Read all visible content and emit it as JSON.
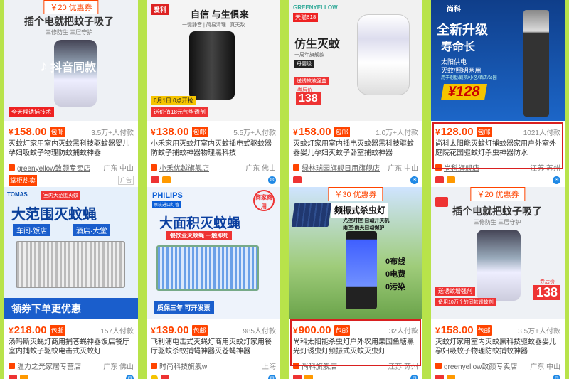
{
  "cards": [
    {
      "coupon": "￥20 优惠券",
      "banner_main": "插个电就把蚊子吸了",
      "banner_sub": "三修防生 三层守护",
      "overlay": "抖音同款",
      "badge": "全天候诱捕技术",
      "price": "158.00",
      "tag": "包邮",
      "sales": "3.5万+人付款",
      "title": "灭蚊灯家用室内灭蚊黑科技驱蚊器婴儿孕妇吸蚊子物理防蚊捕蚊神器",
      "shop": "greenyellow致颜专卖店",
      "location": "广东 中山",
      "extra_badge": "掌柜热卖",
      "ad": "广告"
    },
    {
      "brand": "爱科",
      "banner_main": "自信 与生俱来",
      "banner_sub": "一键静音 | 简易清理 | 真无敌",
      "date_badge": "6月1日 0点开抢",
      "promo": "送价值18元气垫诱剂",
      "price": "138.00",
      "tag": "包邮",
      "sales": "5.5万+人付款",
      "title": "小禾家用灭蚊灯室内灭蚊插电式驱蚊器防蚊子捕蚊神器物理黑科技",
      "shop": "小禾优越旗舰店",
      "location": "广东 佛山"
    },
    {
      "brand": "GREENYELLOW",
      "tmall": "天猫618",
      "banner_main": "仿生灭蚊",
      "banner_sub": "十周年旗舰款",
      "banner_sub2": "母婴级",
      "promo": "送诱蚊液强盒",
      "price_tag_label": "券后价",
      "price_tag": "138",
      "price": "158.00",
      "tag": "包邮",
      "sales": "1.0万+人付款",
      "title": "灭蚊灯家用室内插电灭蚊器黑科技驱蚊器婴儿孕妇灭蚊子卧室捕蚊神器",
      "shop": "绿林瑞园旗舰日用旗舰店",
      "location": "广东 中山"
    },
    {
      "brand": "尚科",
      "banner_main": "全新升级",
      "banner_main2": "寿命长",
      "banner_sub": "太阳供电",
      "banner_sub2": "灭蚊/照明两用",
      "banner_sub3": "用于别墅/庭院/小区/酒店/公园",
      "price_tag": "128",
      "price": "128.00",
      "tag": "包邮",
      "sales": "1021人付款",
      "title": "尚科太阳能灭蚊灯捕蚊器家用户外室外庭院花园驱蚊灯杀虫神器防水",
      "shop": "尚科旗舰店",
      "location": "江苏 苏州"
    },
    {
      "brand": "TOMAS",
      "brand_badge": "室内大范围灭蚊",
      "banner_main": "大范围灭蚊蝇",
      "chips": [
        "车间·饭店",
        "酒店·大堂"
      ],
      "banner_bottom": "领券下单更优惠",
      "price": "218.00",
      "tag": "包邮",
      "sales": "157人付款",
      "title": "汤玛斯灭蝇灯商用捕苍蝇神器饭店餐厅室内捕蚊子驱蚊电击式灭蚊灯",
      "shop": "温力之光家居专营店",
      "location": "广东 佛山"
    },
    {
      "brand": "PHILIPS",
      "brand_sub": "原装进口灯管",
      "seal": "商家商用",
      "banner_main": "大面积灭蚊蝇",
      "banner_sub": "餐饮业灭蚊蝇 一触即死",
      "banner_bottom": "质保三年 可开发票",
      "price": "139.00",
      "tag": "包邮",
      "sales": "985人付款",
      "title": "飞利浦电击式灭蝇灯商用灭蚊灯家用餐厅驱蚊杀蚊捕蝇神器灭苍蝇神器",
      "shop": "时尚科技旗舰w",
      "location": "上海"
    },
    {
      "coupon": "￥30 优惠券",
      "banner_main": "频振式杀虫灯",
      "banner_sub": "光控时控·自动开关机",
      "banner_sub2": "雨控·雨天自动保护",
      "stats": [
        "0布线",
        "0电费",
        "0污染"
      ],
      "price": "900.00",
      "tag": "包邮",
      "sales": "32人付款",
      "title": "尚科太阳能杀虫灯户外农用果园鱼塘黑光灯诱虫灯频振式灭蚊灭虫灯",
      "shop": "尚科旗舰店",
      "location": "江苏 苏州"
    },
    {
      "coupon": "￥20 优惠券",
      "banner_main": "插个电就把蚊子吸了",
      "banner_sub": "三修防生 三层守护",
      "promo": "送诱蚊增强剂",
      "promo2": "备用10万个的同款诱蚊剂",
      "price_tag_label": "券后价",
      "price_tag": "138",
      "price": "158.00",
      "tag": "包邮",
      "sales": "3.5万+人付款",
      "title": "灭蚊灯家用室内灭蚊黑科技驱蚊器婴儿孕妇吸蚊子物理防蚊捕蚊神器",
      "shop": "greenyellow致颜专卖店",
      "location": "广东 中山"
    }
  ]
}
